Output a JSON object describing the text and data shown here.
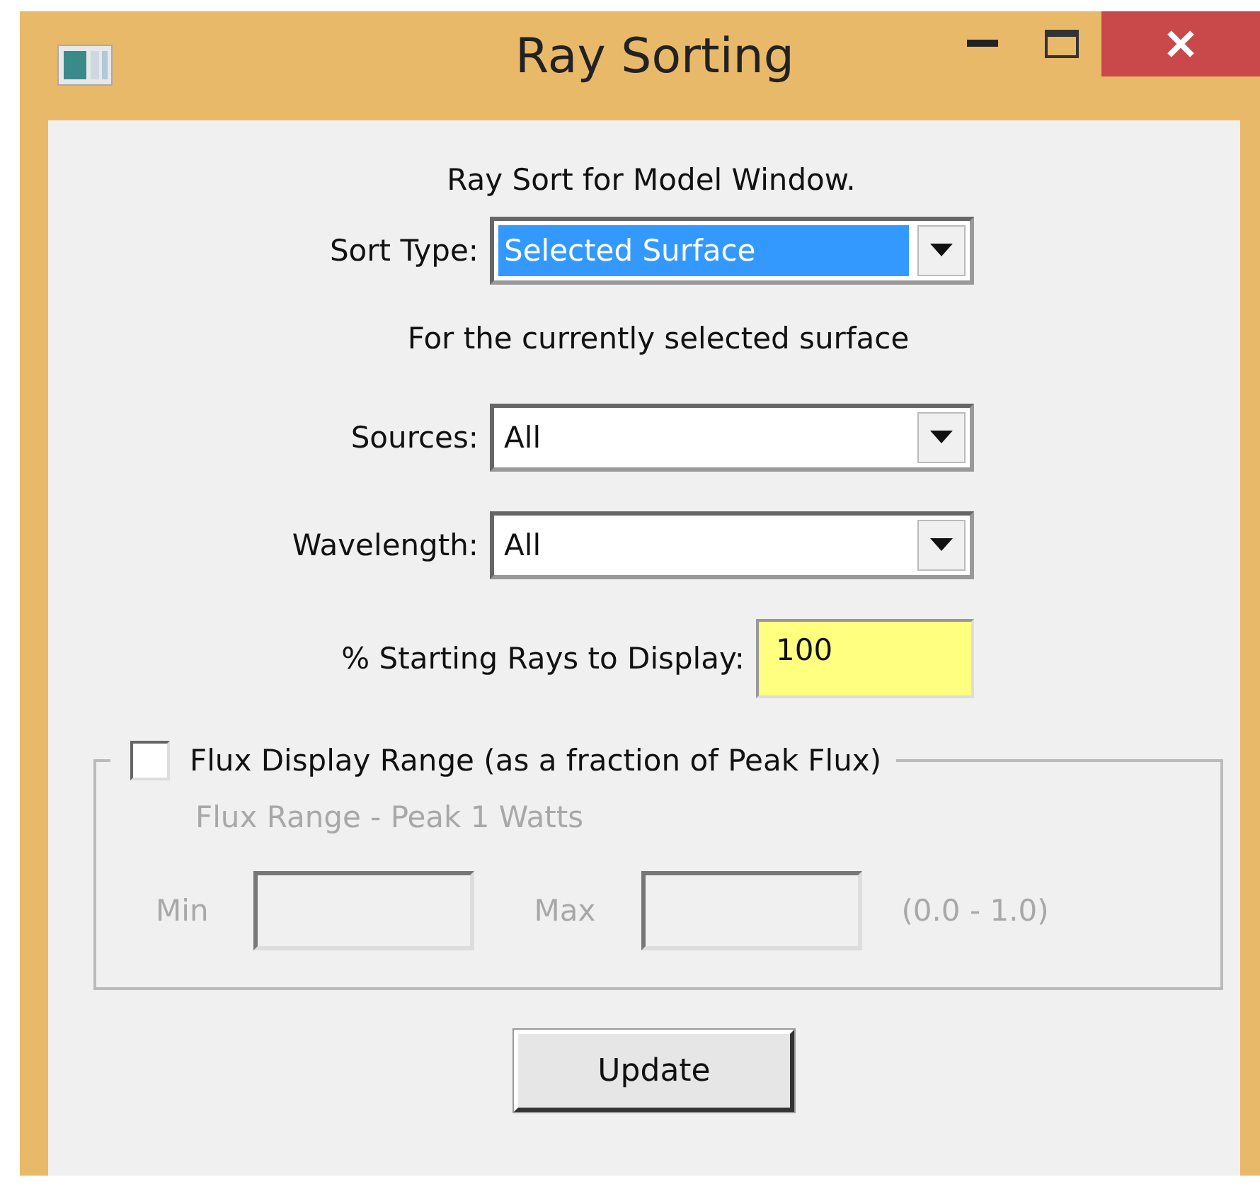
{
  "window": {
    "title": "Ray Sorting"
  },
  "heading": "Ray Sort for Model Window.",
  "rows": [
    {
      "kind": "select",
      "label": "Sort Type:",
      "value": "Selected Surface",
      "highlighted": true
    },
    {
      "kind": "note",
      "text": "For the currently selected surface"
    },
    {
      "kind": "select",
      "label": "Sources:",
      "value": "All",
      "highlighted": false
    },
    {
      "kind": "select",
      "label": "Wavelength:",
      "value": "All",
      "highlighted": false
    },
    {
      "kind": "input",
      "label": "% Starting Rays to Display:",
      "value": "100"
    }
  ],
  "flux_group": {
    "checked": false,
    "label": "Flux Display Range (as a fraction of Peak Flux)",
    "disabled": true,
    "subtitle": "Flux Range - Peak 1 Watts",
    "min_label": "Min",
    "max_label": "Max",
    "range_hint": "(0.0 - 1.0)"
  },
  "buttons": [
    "Update"
  ]
}
